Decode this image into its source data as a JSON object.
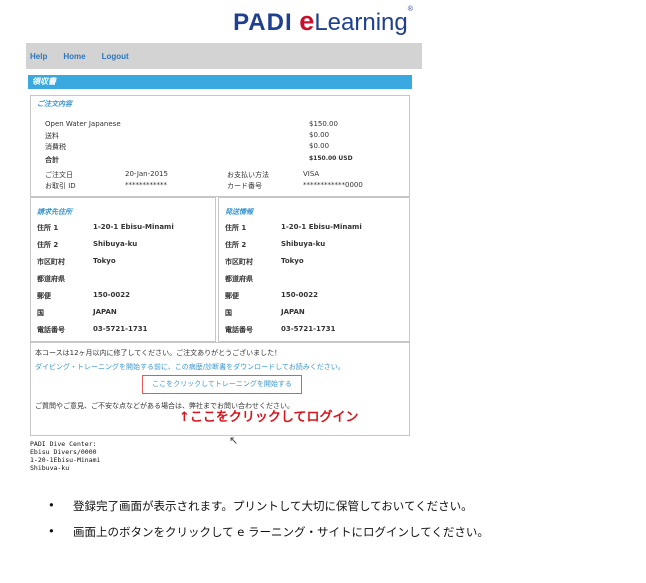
{
  "logo": {
    "padi": "PADI",
    "e": "e",
    "rest": "Learning",
    "tm": "®"
  },
  "nav": {
    "help": "Help",
    "home": "Home",
    "logout": "Logout"
  },
  "section_bar": "領収書",
  "order": {
    "title": "ご注文内容",
    "product": "Open Water Japanese",
    "product_price": "$150.00",
    "shipping_label": "送料",
    "shipping_value": "$0.00",
    "tax_label": "消費税",
    "tax_value": "$0.00",
    "total_label": "合計",
    "total_value": "$150.00 USD",
    "date_label": "ご注文日",
    "date_value": "20-Jan-2015",
    "payment_label": "お支払い方法",
    "payment_value": "VISA",
    "txn_label": "お取引 ID",
    "txn_value": "************",
    "card_label": "カード番号",
    "card_value": "************0000"
  },
  "billing": {
    "title": "請求先住所",
    "rows": [
      {
        "k": "住所 1",
        "v": "1-20-1 Ebisu-Minami"
      },
      {
        "k": "住所 2",
        "v": "Shibuya-ku"
      },
      {
        "k": "市区町村",
        "v": "Tokyo"
      },
      {
        "k": "都道府県",
        "v": ""
      },
      {
        "k": "郵便",
        "v": "150-0022"
      },
      {
        "k": "国",
        "v": "JAPAN"
      },
      {
        "k": "電話番号",
        "v": "03-5721-1731"
      }
    ]
  },
  "shipping": {
    "title": "発送情報",
    "rows": [
      {
        "k": "住所 1",
        "v": "1-20-1 Ebisu-Minami"
      },
      {
        "k": "住所 2",
        "v": "Shibuya-ku"
      },
      {
        "k": "市区町村",
        "v": "Tokyo"
      },
      {
        "k": "都道府県",
        "v": ""
      },
      {
        "k": "郵便",
        "v": "150-0022"
      },
      {
        "k": "国",
        "v": "JAPAN"
      },
      {
        "k": "電話番号",
        "v": "03-5721-1731"
      }
    ]
  },
  "message": {
    "line1": "本コースは12ヶ月以内に修了してください。ご注文ありがとうございました！",
    "line2": "ダイビング・トレーニングを開始する前に、この病歴/診断書をダウンロードしてお読みください。",
    "start_button": "ここをクリックしてトレーニングを開始する",
    "line3": "ご質問やご意見、ご不安な点などがある場合は、弊社までお問い合わせください。",
    "annotation": "↑ここをクリックしてログイン"
  },
  "dive_center": {
    "l1": "PADI Dive Center:",
    "l2": "Ebisu Divers/0000",
    "l3": "1-20-1Ebisu-Minami",
    "l4": "Shibuya-ku"
  },
  "bullets": [
    "登録完了画面が表示されます。プリントして大切に保管しておいてください。",
    "画面上のボタンをクリックして e ラーニング・サイトにログインしてください。"
  ],
  "bullet_char": "•",
  "cursor_glyph": "↖"
}
